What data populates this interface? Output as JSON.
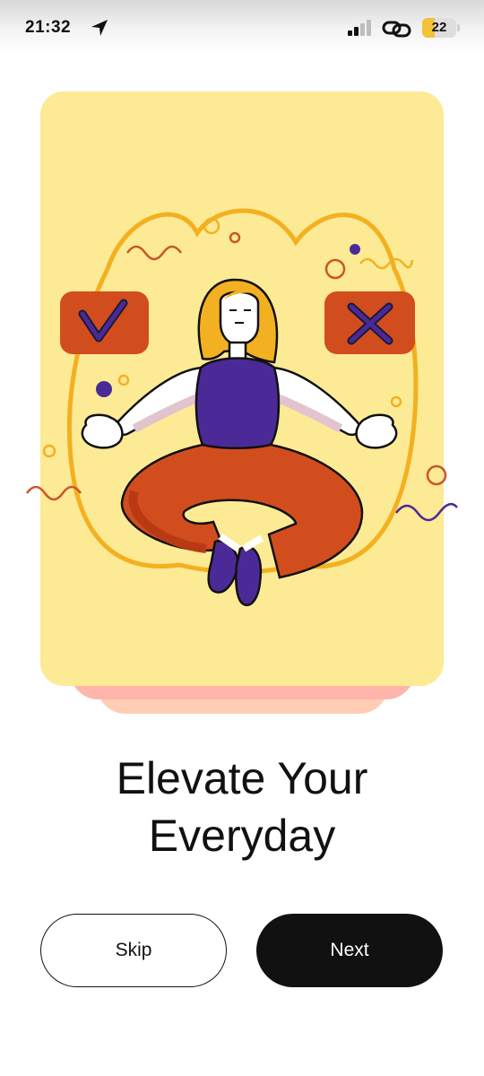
{
  "status_bar": {
    "time": "21:32",
    "battery_level": "22",
    "icons": [
      "location-arrow-icon",
      "signal-bars-icon",
      "link-icon",
      "battery-icon"
    ]
  },
  "illustration": {
    "subject": "meditating-woman",
    "left_badge_icon": "checkmark-icon",
    "right_badge_icon": "cross-icon",
    "colors": {
      "card_background": "#fdea95",
      "badge": "#d24d1d",
      "accent_purple": "#4b2a98",
      "accent_orange": "#f3b020",
      "stack_pink": "#ffb4ac",
      "stack_peach": "#ffcdb4"
    }
  },
  "onboarding": {
    "title_line1": "Elevate Your",
    "title_line2": "Everyday"
  },
  "actions": {
    "skip_label": "Skip",
    "next_label": "Next"
  }
}
